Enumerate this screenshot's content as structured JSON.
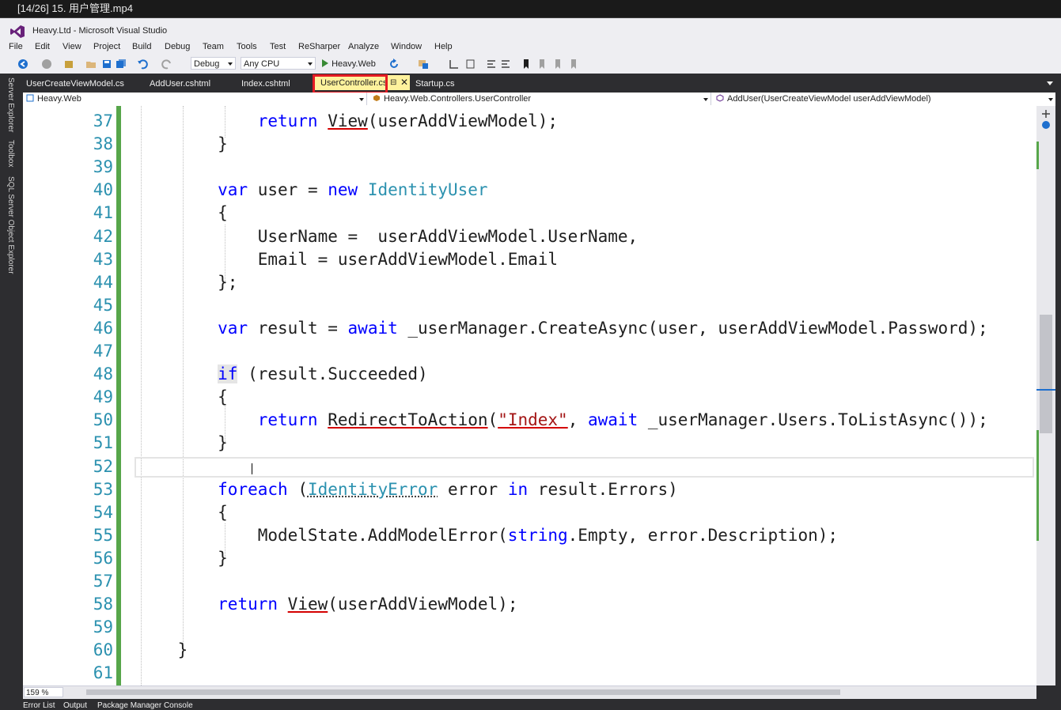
{
  "player": {
    "title": "[14/26] 15. 用户管理.mp4"
  },
  "window": {
    "title": "Heavy.Ltd - Microsoft Visual Studio"
  },
  "menu": [
    "File",
    "Edit",
    "View",
    "Project",
    "Build",
    "Debug",
    "Team",
    "Tools",
    "Test",
    "ReSharper",
    "Analyze",
    "Window",
    "Help"
  ],
  "toolbar": {
    "config": "Debug",
    "platform": "Any CPU",
    "run_target": "Heavy.Web"
  },
  "dock": {
    "server_explorer": "Server Explorer",
    "toolbox": "Toolbox",
    "sql_explorer": "SQL Server Object Explorer"
  },
  "tabs": {
    "t1": "UserCreateViewModel.cs",
    "t2": "AddUser.cshtml",
    "t3": "Index.cshtml",
    "active": "UserController.cs",
    "t5": "Startup.cs",
    "pin_icon": "pin-icon",
    "close_icon": "close-icon"
  },
  "navbar": {
    "project": "Heavy.Web",
    "class": "Heavy.Web.Controllers.UserController",
    "member": "AddUser(UserCreateViewModel userAddViewModel)"
  },
  "editor": {
    "line_numbers": [
      "37",
      "38",
      "39",
      "40",
      "41",
      "42",
      "43",
      "44",
      "45",
      "46",
      "47",
      "48",
      "49",
      "50",
      "51",
      "52",
      "53",
      "54",
      "55",
      "56",
      "57",
      "58",
      "59",
      "60",
      "61"
    ],
    "lines": [
      [
        {
          "t": "            "
        },
        {
          "t": "return",
          "c": "kw"
        },
        {
          "t": " "
        },
        {
          "t": "View",
          "c": "squig"
        },
        {
          "t": "(userAddViewModel);"
        }
      ],
      [
        {
          "t": "        }"
        }
      ],
      [
        {
          "t": ""
        }
      ],
      [
        {
          "t": "        "
        },
        {
          "t": "var",
          "c": "kw"
        },
        {
          "t": " user = "
        },
        {
          "t": "new",
          "c": "kw"
        },
        {
          "t": " "
        },
        {
          "t": "IdentityUser",
          "c": "ty"
        }
      ],
      [
        {
          "t": "        {"
        }
      ],
      [
        {
          "t": "            UserName =  userAddViewModel.UserName,"
        }
      ],
      [
        {
          "t": "            Email = userAddViewModel.Email"
        }
      ],
      [
        {
          "t": "        };"
        }
      ],
      [
        {
          "t": ""
        }
      ],
      [
        {
          "t": "        "
        },
        {
          "t": "var",
          "c": "kw"
        },
        {
          "t": " result = "
        },
        {
          "t": "await",
          "c": "kw"
        },
        {
          "t": " _userManager.CreateAsync(user, userAddViewModel.Password);"
        }
      ],
      [
        {
          "t": ""
        }
      ],
      [
        {
          "t": "        "
        },
        {
          "t": "if",
          "c": "kw kwhl"
        },
        {
          "t": " (result.Succeeded)"
        }
      ],
      [
        {
          "t": "        {"
        }
      ],
      [
        {
          "t": "            "
        },
        {
          "t": "return",
          "c": "kw"
        },
        {
          "t": " "
        },
        {
          "t": "RedirectToAction",
          "c": "squig"
        },
        {
          "t": "("
        },
        {
          "t": "\"Index\"",
          "c": "str squig"
        },
        {
          "t": ", "
        },
        {
          "t": "await",
          "c": "kw"
        },
        {
          "t": " _userManager.Users.ToListAsync());"
        }
      ],
      [
        {
          "t": "        }"
        }
      ],
      [
        {
          "t": ""
        }
      ],
      [
        {
          "t": "        "
        },
        {
          "t": "foreach",
          "c": "kw"
        },
        {
          "t": " ("
        },
        {
          "t": "IdentityError",
          "c": "ty dots"
        },
        {
          "t": " error "
        },
        {
          "t": "in",
          "c": "kw"
        },
        {
          "t": " result.Errors)"
        }
      ],
      [
        {
          "t": "        {"
        }
      ],
      [
        {
          "t": "            ModelState.AddModelError("
        },
        {
          "t": "string",
          "c": "kw"
        },
        {
          "t": ".Empty, error.Description);"
        }
      ],
      [
        {
          "t": "        }"
        }
      ],
      [
        {
          "t": ""
        }
      ],
      [
        {
          "t": "        "
        },
        {
          "t": "return",
          "c": "kw"
        },
        {
          "t": " "
        },
        {
          "t": "View",
          "c": "squig"
        },
        {
          "t": "(userAddViewModel);"
        }
      ],
      [
        {
          "t": ""
        }
      ],
      [
        {
          "t": "    }"
        }
      ],
      [
        {
          "t": ""
        }
      ]
    ]
  },
  "zoom": {
    "value": "159 %"
  },
  "bottom_tabs": {
    "errors": "Error List",
    "output": "Output",
    "pmc": "Package Manager Console"
  },
  "colors": {
    "accent": "#57a64a",
    "keyword": "#0000ff",
    "type": "#2b91af",
    "string": "#a31515",
    "active_tab": "#fff29d",
    "highlight": "#e41b23"
  }
}
